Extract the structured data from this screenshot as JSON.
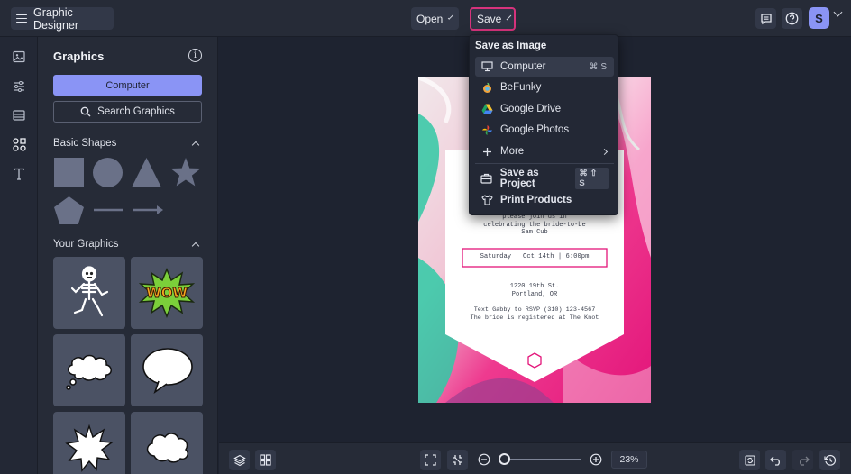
{
  "app": {
    "title": "Graphic Designer"
  },
  "topbar": {
    "open_label": "Open",
    "save_label": "Save",
    "avatar_initial": "S"
  },
  "panel": {
    "title": "Graphics",
    "computer_label": "Computer",
    "search_label": "Search Graphics",
    "basic_shapes_label": "Basic Shapes",
    "your_graphics_label": "Your Graphics",
    "shapes": [
      "square",
      "circle",
      "triangle",
      "star",
      "pentagon",
      "line",
      "arrow"
    ],
    "graphics": [
      "skeleton",
      "wow-burst",
      "cloud-bubble",
      "speech-bubble",
      "spiky-bubble",
      "cloud-bubble-2"
    ]
  },
  "save_menu": {
    "header": "Save as Image",
    "items": [
      {
        "label": "Computer",
        "icon": "monitor-icon",
        "shortcut": "⌘ S"
      },
      {
        "label": "BeFunky",
        "icon": "befunky-icon"
      },
      {
        "label": "Google Drive",
        "icon": "google-drive-icon"
      },
      {
        "label": "Google Photos",
        "icon": "google-photos-icon"
      },
      {
        "label": "More",
        "icon": "plus-icon"
      }
    ],
    "project_label": "Save as Project",
    "project_shortcut": "⌘ ⇧ S",
    "print_label": "Print Products"
  },
  "invite": {
    "line1": "please join us in",
    "line2": "celebrating the bride-to-be",
    "line3": "Sam Cub",
    "date": "Saturday | Oct 14th | 6:00pm",
    "addr1": "1220 19th St.",
    "addr2": "Portland, OR",
    "rsvp": "Text Gabby to RSVP (310) 123-4567",
    "registry": "The bride is registered at The Knot"
  },
  "bottombar": {
    "zoom": "23%"
  },
  "colors": {
    "accent": "#8a94f5",
    "save_outline": "#d6337c",
    "bg": "#1e2330"
  }
}
